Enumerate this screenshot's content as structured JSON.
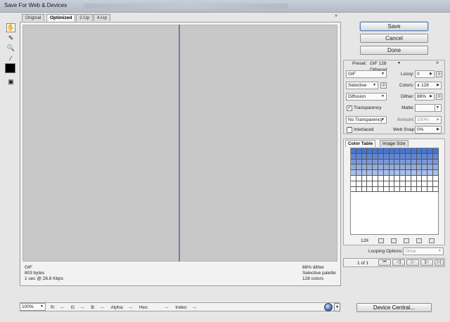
{
  "window": {
    "title": "Save For Web & Devices"
  },
  "tabs": [
    "Original",
    "Optimized",
    "2-Up",
    "4-Up"
  ],
  "collapse_glyph": "»",
  "tools": [
    "hand-icon",
    "slice-select-icon",
    "zoom-icon",
    "eyedropper-icon",
    "toggle-slices-icon"
  ],
  "eyedropper_color": "#000000",
  "preview": {
    "left_info": [
      "GIF",
      "803 bytes",
      "1 sec @ 28.8 Kbps"
    ],
    "right_info": [
      "88% dither",
      "Selective palette",
      "128 colors"
    ]
  },
  "buttons": {
    "save": "Save",
    "cancel": "Cancel",
    "done": "Done",
    "device_central": "Device Central..."
  },
  "settings": {
    "preset_label": "Preset:",
    "preset_value": "GIF 128 Dithered",
    "format": "GIF",
    "lossy_label": "Lossy:",
    "lossy_value": "0",
    "reduction": "Selective",
    "colors_label": "Colors:",
    "colors_value": "128",
    "dither_algo": "Diffusion",
    "dither_label": "Dither:",
    "dither_value": "88%",
    "transparency_label": "Transparency",
    "transparency_checked": true,
    "matte_label": "Matte:",
    "transparency_dither": "No Transparency ...",
    "amount_label": "Amount:",
    "amount_value": "100%",
    "interlaced_label": "Interlaced",
    "interlaced_checked": false,
    "websnap_label": "Web Snap:",
    "websnap_value": "0%"
  },
  "panel_tabs": [
    "Color Table",
    "Image Size"
  ],
  "color_table": {
    "count": "128"
  },
  "animation": {
    "looping_label": "Looping Options:",
    "looping_value": "Once",
    "frame_counter": "1 of 1"
  },
  "status_bar": {
    "zoom": "100%",
    "r": "R:",
    "r_val": "--",
    "g": "G:",
    "g_val": "--",
    "b": "B:",
    "b_val": "--",
    "alpha": "Alpha:",
    "alpha_val": "--",
    "hex": "Hex:",
    "hex_val": "--",
    "index": "Index:",
    "index_val": "--"
  }
}
